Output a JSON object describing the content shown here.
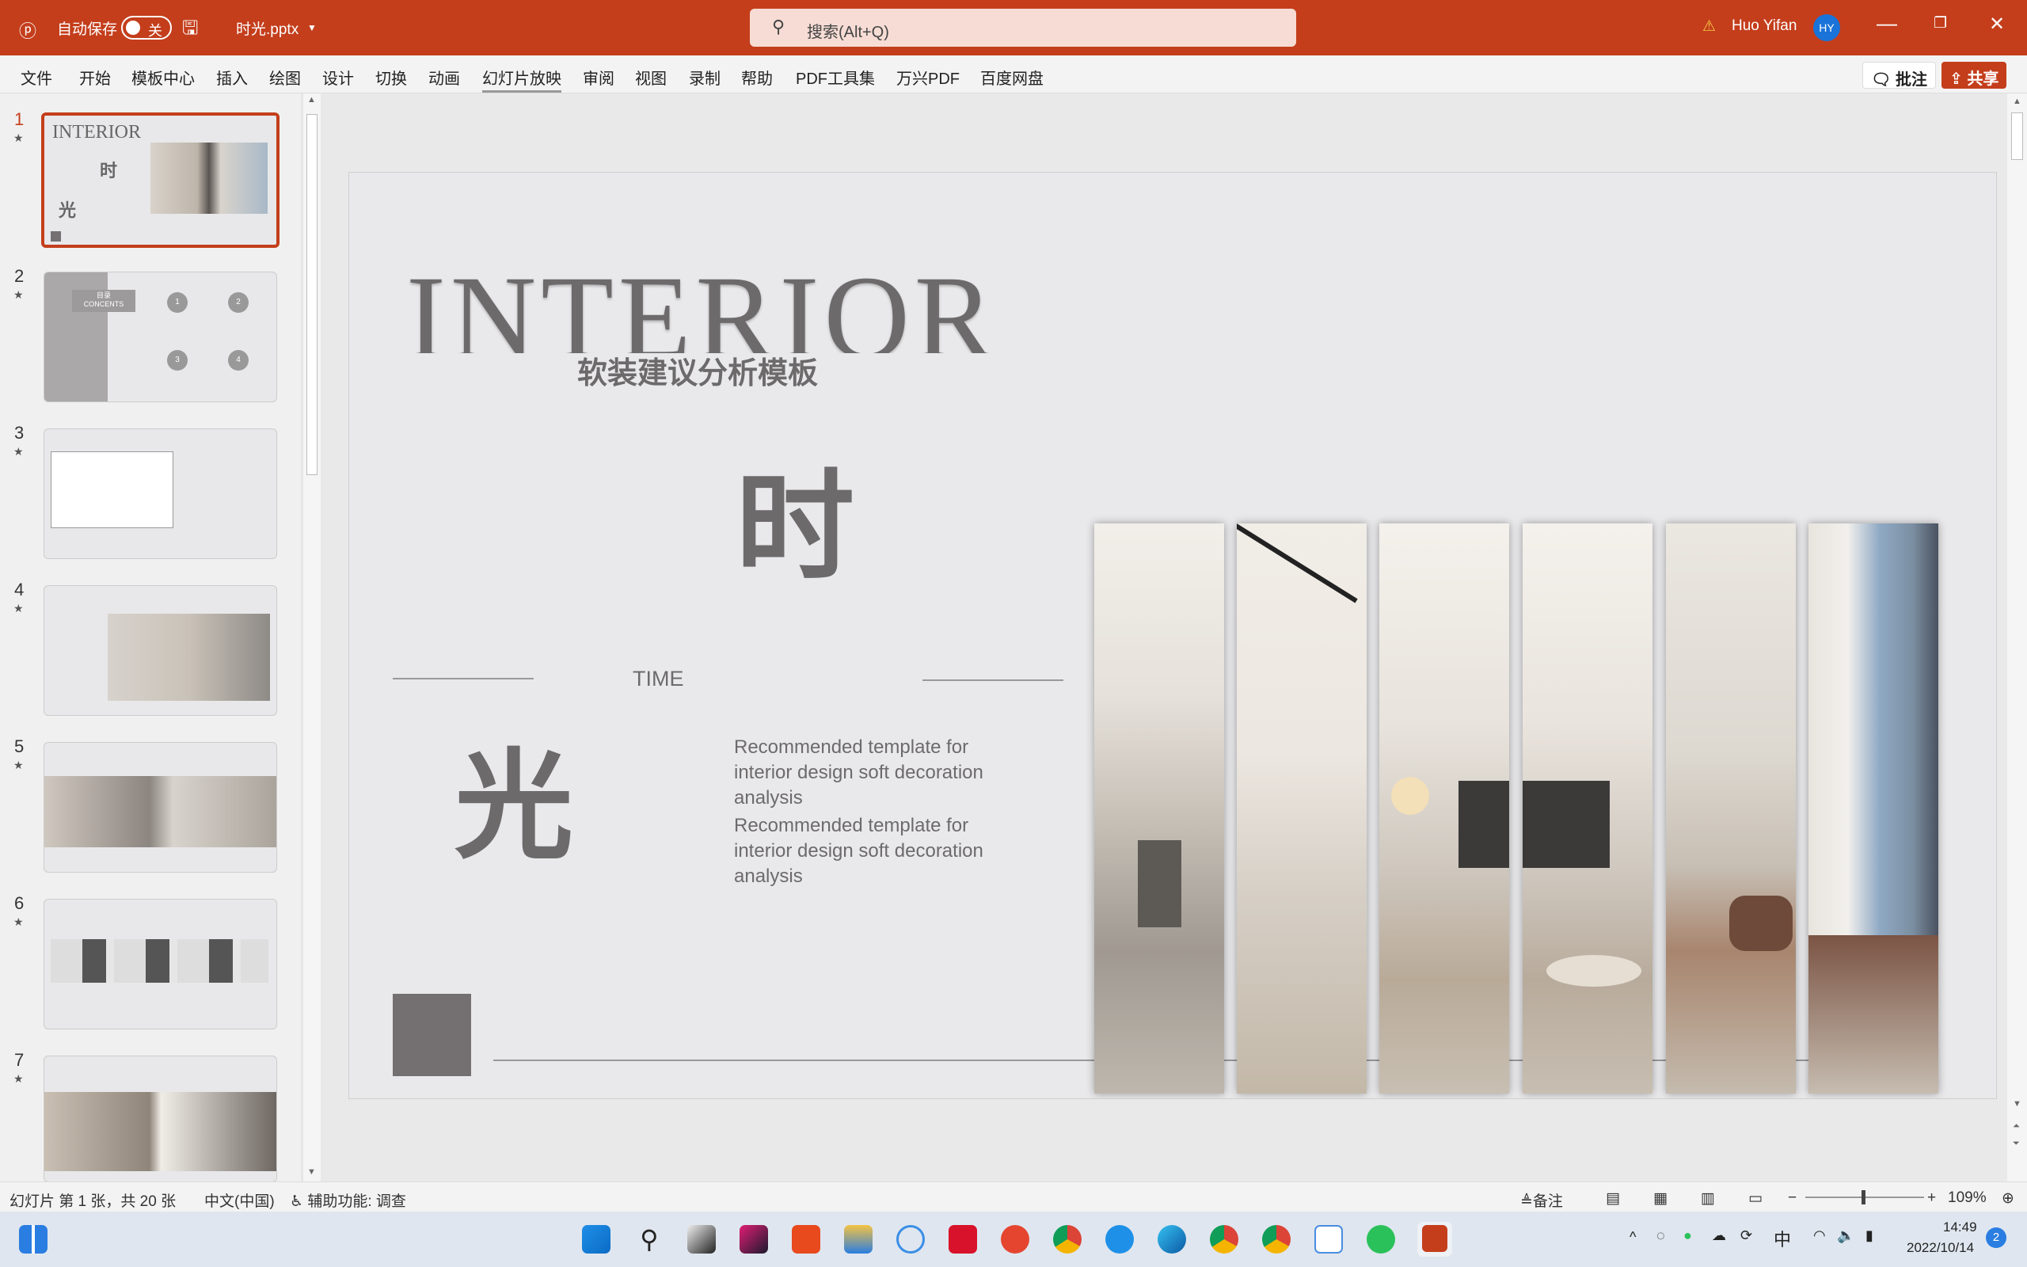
{
  "titlebar": {
    "autosave": "自动保存",
    "toggle": "关",
    "filename": "时光.pptx",
    "search_placeholder": "搜索(Alt+Q)",
    "user": "Huo Yifan",
    "avatar": "HY",
    "accent": "#c43e1c"
  },
  "ribbon": {
    "tabs": [
      "文件",
      "开始",
      "模板中心",
      "插入",
      "绘图",
      "设计",
      "切换",
      "动画",
      "幻灯片放映",
      "审阅",
      "视图",
      "录制",
      "帮助",
      "PDF工具集",
      "万兴PDF",
      "百度网盘"
    ],
    "comments": "批注",
    "share": "共享"
  },
  "slides": [
    {
      "n": "1"
    },
    {
      "n": "2"
    },
    {
      "n": "3"
    },
    {
      "n": "4"
    },
    {
      "n": "5"
    },
    {
      "n": "6"
    },
    {
      "n": "7"
    }
  ],
  "thumb2": {
    "title1": "目录",
    "title2": "CONCENTS",
    "circles": [
      "1",
      "2",
      "3",
      "4"
    ]
  },
  "slide": {
    "heading": "INTERIOR",
    "subtitle": "软装建议分析模板",
    "char1": "时",
    "char2": "光",
    "time": "TIME",
    "para1": "Recommended template for interior design soft decoration analysis",
    "para2": "Recommended template for interior design soft decoration analysis"
  },
  "status": {
    "slide_info": "幻灯片 第 1 张，共 20 张",
    "language": "中文(中国)",
    "accessibility": "辅助功能: 调查",
    "notes": "备注",
    "zoom": "109%",
    "zoom_percent": 109
  },
  "taskbar": {
    "time": "14:49",
    "date": "2022/10/14",
    "ime": "中",
    "badge": "2"
  }
}
